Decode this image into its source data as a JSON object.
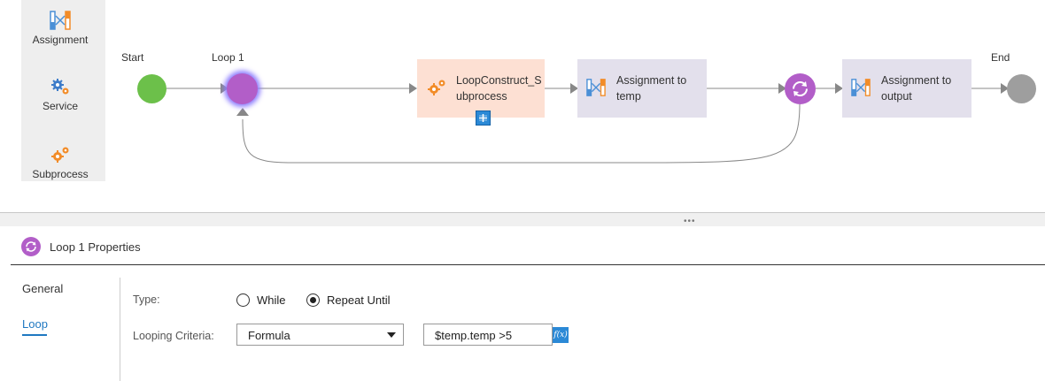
{
  "palette": {
    "items": [
      {
        "label": "Assignment",
        "icon": "assignment-icon"
      },
      {
        "label": "Service",
        "icon": "service-icon"
      },
      {
        "label": "Subprocess",
        "icon": "subprocess-icon"
      }
    ]
  },
  "flow": {
    "start_label": "Start",
    "loop_label": "Loop 1",
    "end_label": "End",
    "steps": [
      {
        "line1": "LoopConstruct_S",
        "line2": "ubprocess",
        "icon": "subprocess-icon",
        "color": "#fde0d3"
      },
      {
        "line1": "Assignment to",
        "line2": "temp",
        "icon": "assignment-icon",
        "color": "#e3e0ec"
      },
      {
        "line1": "Assignment to",
        "line2": "output",
        "icon": "assignment-icon",
        "color": "#e3e0ec"
      }
    ],
    "colors": {
      "start": "#6cc04a",
      "loop": "#b25ec8",
      "end": "#9e9e9e"
    }
  },
  "properties": {
    "title": "Loop 1 Properties",
    "tabs": [
      "General",
      "Loop"
    ],
    "active_tab": "Loop",
    "type_label": "Type:",
    "type_options": [
      "While",
      "Repeat Until"
    ],
    "type_selected": "Repeat Until",
    "criteria_label": "Looping Criteria:",
    "criteria_value": "Formula",
    "formula_value": "$temp.temp >5",
    "fx_label": "f(x)"
  }
}
